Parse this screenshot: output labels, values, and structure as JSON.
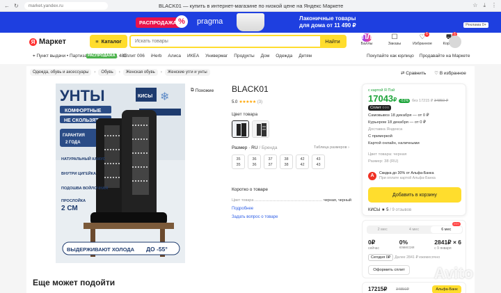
{
  "browser": {
    "url": "market.yandex.ru",
    "tab_title": "BLACK01 — купить в интернет-магазине по низкой цене на Яндекс Маркете"
  },
  "banner": {
    "sale": "РАСПРОДАЖА",
    "sale_pct": "%",
    "brand": "pragma",
    "promo_line1": "Лаконичные товары",
    "promo_line2": "для дома от 11 490 ₽",
    "ad": "Реклама 0+"
  },
  "header": {
    "logo_letter": "Я",
    "logo_name": "Маркет",
    "catalog_label": "Каталог",
    "search_placeholder": "Искать товары",
    "search_button": "Найти",
    "icons": [
      {
        "label": "Баллы",
        "glyph": "ПЛЮС"
      },
      {
        "label": "Заказы",
        "glyph": "☐"
      },
      {
        "label": "Избранное",
        "glyph": "♡",
        "badge": "6"
      },
      {
        "label": "Корзина",
        "glyph": "⛟",
        "badge": "6"
      }
    ]
  },
  "subnav": {
    "pickup": "Пункт выдачи • Партизана Железняка, 48Е",
    "links": [
      "Сплит 006",
      "iHerb",
      "Алиса",
      "ИКЕА",
      "Универмаг",
      "Продукты",
      "Дом",
      "Одежда",
      "Детям"
    ],
    "rasp": "РАСПРОДАЖА",
    "right_links": [
      "Покупайте как юрлицо",
      "Продавайте на Маркете"
    ]
  },
  "breadcrumbs": [
    "Одежда, обувь и аксессуары",
    "Обувь",
    "Женская обувь",
    "Женские угги и унты"
  ],
  "actions": {
    "compare": "Сравнить",
    "favorite": "В избранное"
  },
  "similar": "Похожие",
  "photo": {
    "headline": "УНТЫ",
    "brand": "КИСЫ",
    "feature1": "КОМФОРТНЫЕ",
    "feature2": "НЕ СКОЛЬЗЯТ",
    "guarantee": "ГАРАНТИЯ 2 ГОДА",
    "bullets": [
      "НАТУРАЛЬНЫЙ КАМУС",
      "ВНУТРИ ЦИГЕЙКА",
      "ПОДОШВА ВОЙЛОЧНАЯ",
      "ПРОСЛОЙКА"
    ],
    "layer": "2 СМ",
    "bottom": "ВЫДЕРЖИВАЮТ ХОЛОДА",
    "bottom_temp": "ДО -55°"
  },
  "product": {
    "title": "BLACK01",
    "rating": "5.0",
    "stars": "★★★★★",
    "reviews": "(3)",
    "color_label": "Цвет товара",
    "size_label": "Размер",
    "size_system": "· RU",
    "size_brand": "/ Бренда",
    "size_table": "Таблица размеров",
    "sizes": [
      {
        "top": "35",
        "bottom": "35"
      },
      {
        "top": "36",
        "bottom": "36"
      },
      {
        "top": "37",
        "bottom": "37"
      },
      {
        "top": "38",
        "bottom": "38"
      },
      {
        "top": "42",
        "bottom": "42"
      },
      {
        "top": "43",
        "bottom": "43"
      }
    ],
    "about": "Коротко о товаре",
    "attr_name": "Цвет товара",
    "attr_value": "черная, черный",
    "more_link": "Подробнее",
    "ask_link": "Задать вопрос о товаре"
  },
  "buy": {
    "card_note": "с картой Я Пэй",
    "price": "17043",
    "currency": "₽",
    "discount": "-51%",
    "old_prefix": "без",
    "old_price1": "17215 ₽",
    "old_price2": "34850 ₽",
    "split": "Сплит ○○○",
    "delivery1": "Самовывоз 18 декабря — от 0 ₽",
    "delivery2": "Курьером 18 декабря — от 0 ₽",
    "delivery_note": "Доставка Яндекса",
    "try_on": "С примеркой",
    "payment": "Картой онлайн, наличными",
    "color": "Цвет товара: черная",
    "size": "Размер: 38 (RU)",
    "alfa_letter": "А",
    "alfa_text1": "Скидка до 30% от Альфа-Банка",
    "alfa_text2": "При оплате картой Альфа-Банка",
    "cart": "Добавить в корзину",
    "seller": "КИСЫ",
    "seller_rating": "★ 5",
    "seller_reviews": "/ 9 отзывов"
  },
  "split_card": {
    "tabs": [
      "2 мес",
      "4 мес",
      "6 мес"
    ],
    "badge": "○○○",
    "cols": [
      {
        "v": "0₽",
        "s": "сейчас"
      },
      {
        "v": "0%",
        "s": "комиссия"
      },
      {
        "v": "2841₽ × 6",
        "s": "с 9 января"
      }
    ],
    "today": "Сегодня 0₽",
    "rest": "Далее 2841 ₽ ежемесячно",
    "button": "Оформить сплит"
  },
  "bottom_card": {
    "price": "17215₽",
    "old": "34850₽",
    "button": "Альфа-Банк"
  },
  "section_title": "Еще может подойти",
  "watermark": "Avito"
}
